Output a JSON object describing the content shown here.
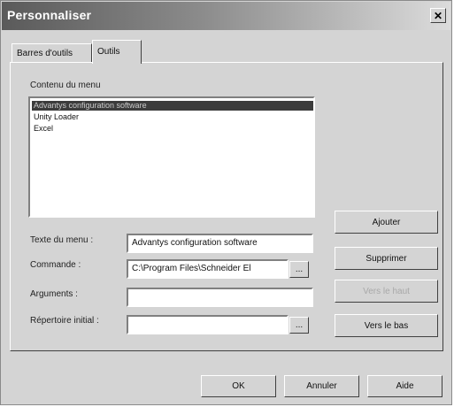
{
  "window": {
    "title": "Personnaliser"
  },
  "tabs": [
    {
      "label": "Barres d'outils"
    },
    {
      "label": "Outils"
    }
  ],
  "menu": {
    "label": "Contenu du menu",
    "items": [
      {
        "label": "Advantys configuration software",
        "selected": true
      },
      {
        "label": "Unity Loader",
        "selected": false
      },
      {
        "label": "Excel",
        "selected": false
      }
    ]
  },
  "form": {
    "menu_text_label": "Texte du menu :",
    "menu_text_value": "Advantys configuration software",
    "command_label": "Commande :",
    "command_value": "C:\\Program Files\\Schneider El",
    "arguments_label": "Arguments :",
    "arguments_value": "",
    "initial_dir_label": "Répertoire initial :",
    "initial_dir_value": "",
    "browse_label": "..."
  },
  "side_buttons": {
    "add": "Ajouter",
    "delete": "Supprimer",
    "move_up": "Vers le haut",
    "move_down": "Vers le bas"
  },
  "footer_buttons": {
    "ok": "OK",
    "cancel": "Annuler",
    "help": "Aide"
  },
  "icons": {
    "close": "close-icon"
  }
}
